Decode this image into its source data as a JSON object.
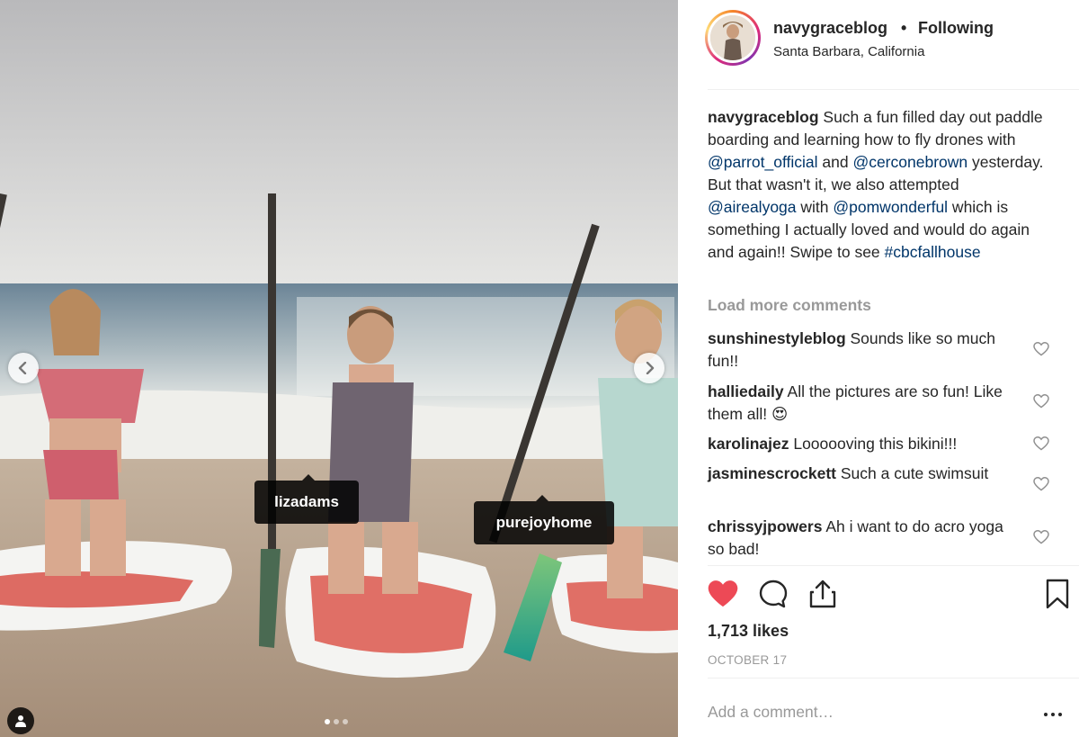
{
  "post": {
    "username": "navygraceblog",
    "follow_status": "Following",
    "location": "Santa Barbara, California"
  },
  "photo": {
    "tags": [
      "lizadams",
      "purejoyhome"
    ],
    "carousel_dots": 3,
    "active_dot": 0
  },
  "caption": {
    "username": "navygraceblog",
    "part1": " Such a fun filled day out paddle boarding and learning how to fly drones with ",
    "mention1": "@parrot_official",
    "part2": " and ",
    "mention2": "@cerconebrown",
    "part3": " yesterday. But that wasn't it, we also attempted ",
    "mention3": "@airealyoga",
    "part4": " with ",
    "mention4": "@pomwonderful",
    "part5": " which is something I actually loved and would do again and again!! Swipe to see ",
    "hashtag": "#cbcfallhouse"
  },
  "load_more": "Load more comments",
  "comments": [
    {
      "username": "sunshinestyleblog",
      "text": " Sounds like so much fun!!"
    },
    {
      "username": "halliedaily",
      "text": " All the pictures are so fun! Like them all! 😍"
    },
    {
      "username": "karolinajez",
      "text": " Loooooving this bikini!!!"
    },
    {
      "username": "jasminescrockett",
      "text": " Such a cute swimsuit"
    },
    {
      "username": "chrissyjpowers",
      "text": " Ah i want to do acro yoga so bad!"
    }
  ],
  "likes": "1,713 likes",
  "date": "OCTOBER 17",
  "comment_input": {
    "placeholder": "Add a comment…",
    "value": ""
  },
  "colors": {
    "like_red": "#ed4956",
    "mention_blue": "#003569",
    "muted_gray": "#999999"
  },
  "icons": [
    "chevron-left-icon",
    "chevron-right-icon",
    "user-tag-icon",
    "heart-filled-icon",
    "comment-icon",
    "share-icon",
    "bookmark-icon",
    "heart-outline-icon",
    "more-dots-icon"
  ]
}
